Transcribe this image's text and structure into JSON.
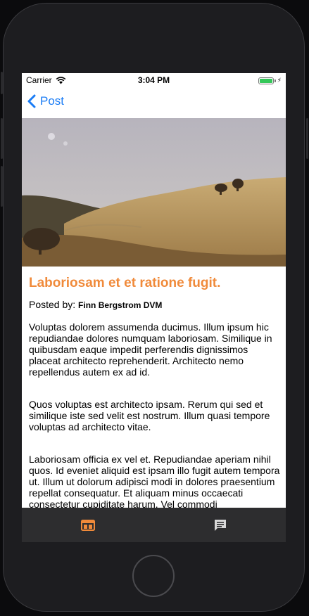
{
  "status_bar": {
    "carrier": "Carrier",
    "time": "3:04 PM",
    "icons": [
      "wifi-icon",
      "battery-icon",
      "charging-bolt-icon"
    ],
    "battery_color": "#35c759"
  },
  "nav": {
    "back_label": "Post",
    "back_icon": "chevron-left-icon",
    "tint_color": "#1a7cf5"
  },
  "post": {
    "title": "Laboriosam et et ratione fugit.",
    "title_color": "#f08a3a",
    "posted_by_label": "Posted by:",
    "author": "Finn Bergstrom DVM",
    "hero_image": "landscape-hills-photo",
    "paragraphs": [
      "Voluptas dolorem assumenda ducimus. Illum ipsum hic repudiandae dolores numquam laboriosam. Similique in quibusdam eaque impedit perferendis dignissimos placeat architecto reprehenderit. Architecto nemo repellendus autem ex ad id.",
      "Quos voluptas est architecto ipsam. Rerum qui sed et similique iste sed velit est nostrum. Illum quasi tempore voluptas ad architecto vitae.",
      "Laboriosam officia ex vel et. Repudiandae aperiam nihil quos. Id eveniet aliquid est ipsam illo fugit autem tempora ut. Illum ut dolorum adipisci modi in dolores praesentium repellat consequatur. Et aliquam minus occaecati consectetur cupiditate harum. Vel commodi"
    ]
  },
  "tab_bar": {
    "tabs": [
      {
        "name": "posts",
        "icon": "web-layout-icon",
        "selected": true
      },
      {
        "name": "comments",
        "icon": "message-icon",
        "selected": false
      }
    ],
    "selected_color": "#f08a3a",
    "unselected_color": "#d8d8d8"
  }
}
